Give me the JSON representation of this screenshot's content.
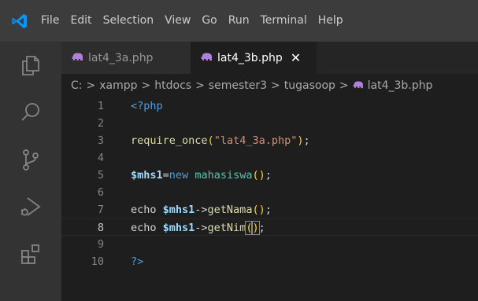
{
  "menubar": {
    "items": [
      "File",
      "Edit",
      "Selection",
      "View",
      "Go",
      "Run",
      "Terminal",
      "Help"
    ]
  },
  "activity_bar": {
    "icons": [
      "explorer-icon",
      "search-icon",
      "source-control-icon",
      "run-debug-icon",
      "extensions-icon"
    ]
  },
  "tabs": [
    {
      "label": "lat4_3a.php",
      "active": false,
      "icon": "php-elephant-icon"
    },
    {
      "label": "lat4_3b.php",
      "active": true,
      "icon": "php-elephant-icon",
      "close": "✕"
    }
  ],
  "breadcrumb": {
    "segments": [
      "C:",
      "xampp",
      "htdocs",
      "semester3",
      "tugasoop",
      "lat4_3b.php"
    ],
    "separator": ">"
  },
  "editor": {
    "current_line": 8,
    "lines": [
      {
        "n": "1",
        "tokens": [
          [
            "tag",
            "<?php"
          ]
        ]
      },
      {
        "n": "2",
        "tokens": []
      },
      {
        "n": "3",
        "tokens": [
          [
            "fn",
            "require_once"
          ],
          [
            "paren",
            "("
          ],
          [
            "str",
            "\"lat4_3a.php\""
          ],
          [
            "paren",
            ")"
          ],
          [
            "plain",
            ";"
          ]
        ]
      },
      {
        "n": "4",
        "tokens": []
      },
      {
        "n": "5",
        "tokens": [
          [
            "var",
            "$mhs1"
          ],
          [
            "op",
            "="
          ],
          [
            "kw",
            "new"
          ],
          [
            "plain",
            " "
          ],
          [
            "cls",
            "mahasiswa"
          ],
          [
            "paren",
            "()"
          ],
          [
            "plain",
            ";"
          ]
        ]
      },
      {
        "n": "6",
        "tokens": []
      },
      {
        "n": "7",
        "tokens": [
          [
            "plain",
            "echo "
          ],
          [
            "var",
            "$mhs1"
          ],
          [
            "op",
            "->"
          ],
          [
            "fn",
            "getNama"
          ],
          [
            "paren",
            "()"
          ],
          [
            "plain",
            ";"
          ]
        ]
      },
      {
        "n": "8",
        "tokens": [
          [
            "plain",
            "echo "
          ],
          [
            "var",
            "$mhs1"
          ],
          [
            "op",
            "->"
          ],
          [
            "fn",
            "getNim"
          ],
          [
            "paren",
            "("
          ],
          [
            "cursor",
            ""
          ],
          [
            "paren",
            ")"
          ],
          [
            "plain",
            ";"
          ]
        ]
      },
      {
        "n": "9",
        "tokens": []
      },
      {
        "n": "10",
        "tokens": [
          [
            "tag",
            "?>"
          ]
        ]
      }
    ]
  },
  "colors": {
    "menubar_bg": "#3c3c3c",
    "activity_bg": "#333333",
    "editor_bg": "#1e1e1e",
    "vscode_blue": "#0098ff",
    "php_elephant": "#b180d7"
  }
}
